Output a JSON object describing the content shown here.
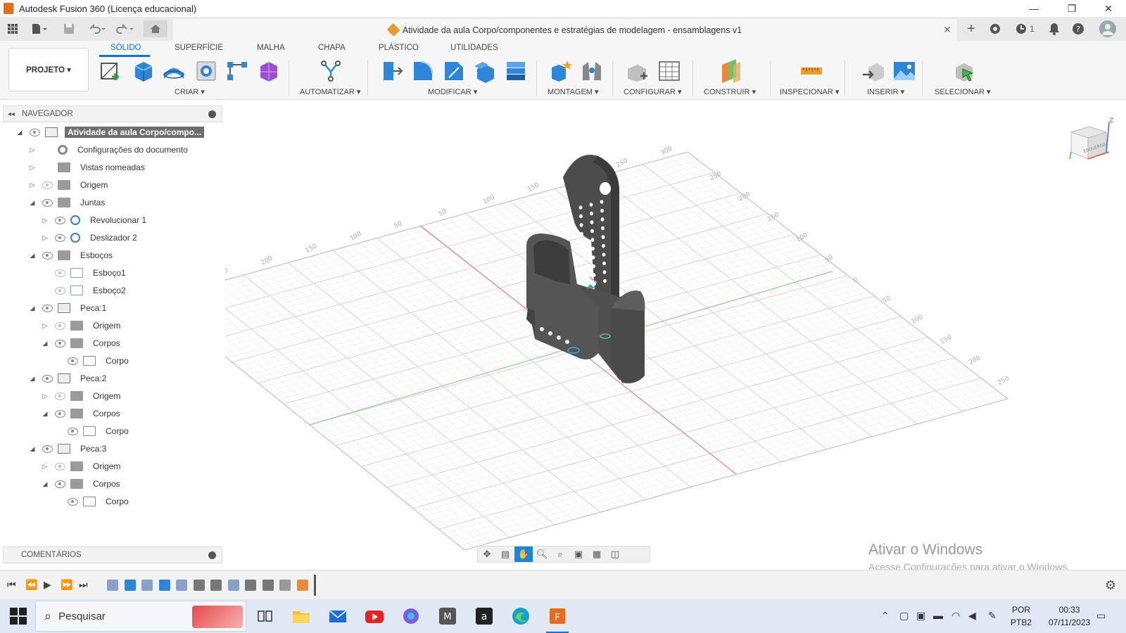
{
  "window": {
    "title": "Autodesk Fusion 360 (Licença educacional)",
    "minimize": "—",
    "restore": "❐",
    "close": "✕"
  },
  "document": {
    "title": "Atividade da aula Corpo/componentes e estratégias de modelagem - ensamblagens v1",
    "close": "✕"
  },
  "quick_access": {
    "notifications_count": "1"
  },
  "ribbon": {
    "project_label": "PROJETO ▾",
    "tabs": [
      "SÓLIDO",
      "SUPERFÍCIE",
      "MALHA",
      "CHAPA",
      "PLÁSTICO",
      "UTILIDADES"
    ],
    "groups": [
      "CRIAR ▾",
      "AUTOMATIZAR ▾",
      "MODIFICAR ▾",
      "MONTAGEM ▾",
      "CONFIGURAR ▾",
      "CONSTRUIR ▾",
      "INSPECIONAR ▾",
      "INSERIR ▾",
      "SELECIONAR ▾"
    ]
  },
  "navigator": {
    "title": "NAVEGADOR",
    "items": [
      {
        "label": "Atividade da aula Corpo/compo...",
        "icon": "component-icon",
        "level": 0,
        "exp": "◢",
        "eye": true
      },
      {
        "label": "Configurações do documento",
        "icon": "gear-icon",
        "level": 1,
        "exp": "▷",
        "eye": false
      },
      {
        "label": "Vistas nomeadas",
        "icon": "folder-icon",
        "level": 1,
        "exp": "▷",
        "eye": false
      },
      {
        "label": "Origem",
        "icon": "folder-icon",
        "level": 1,
        "exp": "▷",
        "eye": "off"
      },
      {
        "label": "Juntas",
        "icon": "folder-icon",
        "level": 1,
        "exp": "◢",
        "eye": true
      },
      {
        "label": "Revolucionar 1",
        "icon": "joint-icon",
        "level": 2,
        "exp": "▷",
        "eye": true
      },
      {
        "label": "Deslizador 2",
        "icon": "joint-icon",
        "level": 2,
        "exp": "▷",
        "eye": true
      },
      {
        "label": "Esboços",
        "icon": "folder-icon",
        "level": 1,
        "exp": "◢",
        "eye": true
      },
      {
        "label": "Esboço1",
        "icon": "sketch-icon",
        "level": 2,
        "exp": "",
        "eye": "off"
      },
      {
        "label": "Esboço2",
        "icon": "sketch-icon",
        "level": 2,
        "exp": "",
        "eye": "off"
      },
      {
        "label": "Peca:1",
        "icon": "component-icon",
        "level": 1,
        "exp": "◢",
        "eye": true
      },
      {
        "label": "Origem",
        "icon": "folder-icon",
        "level": 2,
        "exp": "▷",
        "eye": "off"
      },
      {
        "label": "Corpos",
        "icon": "folder-icon",
        "level": 2,
        "exp": "◢",
        "eye": true
      },
      {
        "label": "Corpo",
        "icon": "body-icon",
        "level": 3,
        "exp": "",
        "eye": true
      },
      {
        "label": "Peca:2",
        "icon": "component-icon",
        "level": 1,
        "exp": "◢",
        "eye": true
      },
      {
        "label": "Origem",
        "icon": "folder-icon",
        "level": 2,
        "exp": "▷",
        "eye": "off"
      },
      {
        "label": "Corpos",
        "icon": "folder-icon",
        "level": 2,
        "exp": "◢",
        "eye": true
      },
      {
        "label": "Corpo",
        "icon": "body-icon",
        "level": 3,
        "exp": "",
        "eye": true
      },
      {
        "label": "Peca:3",
        "icon": "component-icon",
        "level": 1,
        "exp": "◢",
        "eye": true
      },
      {
        "label": "Origem",
        "icon": "folder-icon",
        "level": 2,
        "exp": "▷",
        "eye": "off"
      },
      {
        "label": "Corpos",
        "icon": "folder-icon",
        "level": 2,
        "exp": "◢",
        "eye": true
      },
      {
        "label": "Corpo",
        "icon": "body-icon",
        "level": 3,
        "exp": "",
        "eye": true
      }
    ]
  },
  "comments": {
    "title": "COMENTÁRIOS"
  },
  "grid_labels": [
    "300",
    "250",
    "200",
    "150",
    "100",
    "50",
    "50",
    "100",
    "150",
    "200",
    "250",
    "300",
    "250",
    "200",
    "150",
    "100",
    "50",
    "0",
    "50",
    "100",
    "150",
    "200",
    "250"
  ],
  "viewcube": {
    "face_label": "ESQUERDA",
    "axis_z": "Z"
  },
  "watermark": {
    "title": "Ativar o Windows",
    "subtitle": "Acesse Configurações para ativar o Windows."
  },
  "taskbar": {
    "search_placeholder": "Pesquisar",
    "lang_top": "POR",
    "lang_bottom": "PTB2",
    "time": "00:33",
    "date": "07/11/2023"
  },
  "colors": {
    "accent": "#0a74d6",
    "fusion_orange": "#e66b1e",
    "model_gray": "#555555",
    "grid_line": "#d9d9d9",
    "x_axis": "#e88a8a",
    "y_axis": "#8fd18f"
  }
}
